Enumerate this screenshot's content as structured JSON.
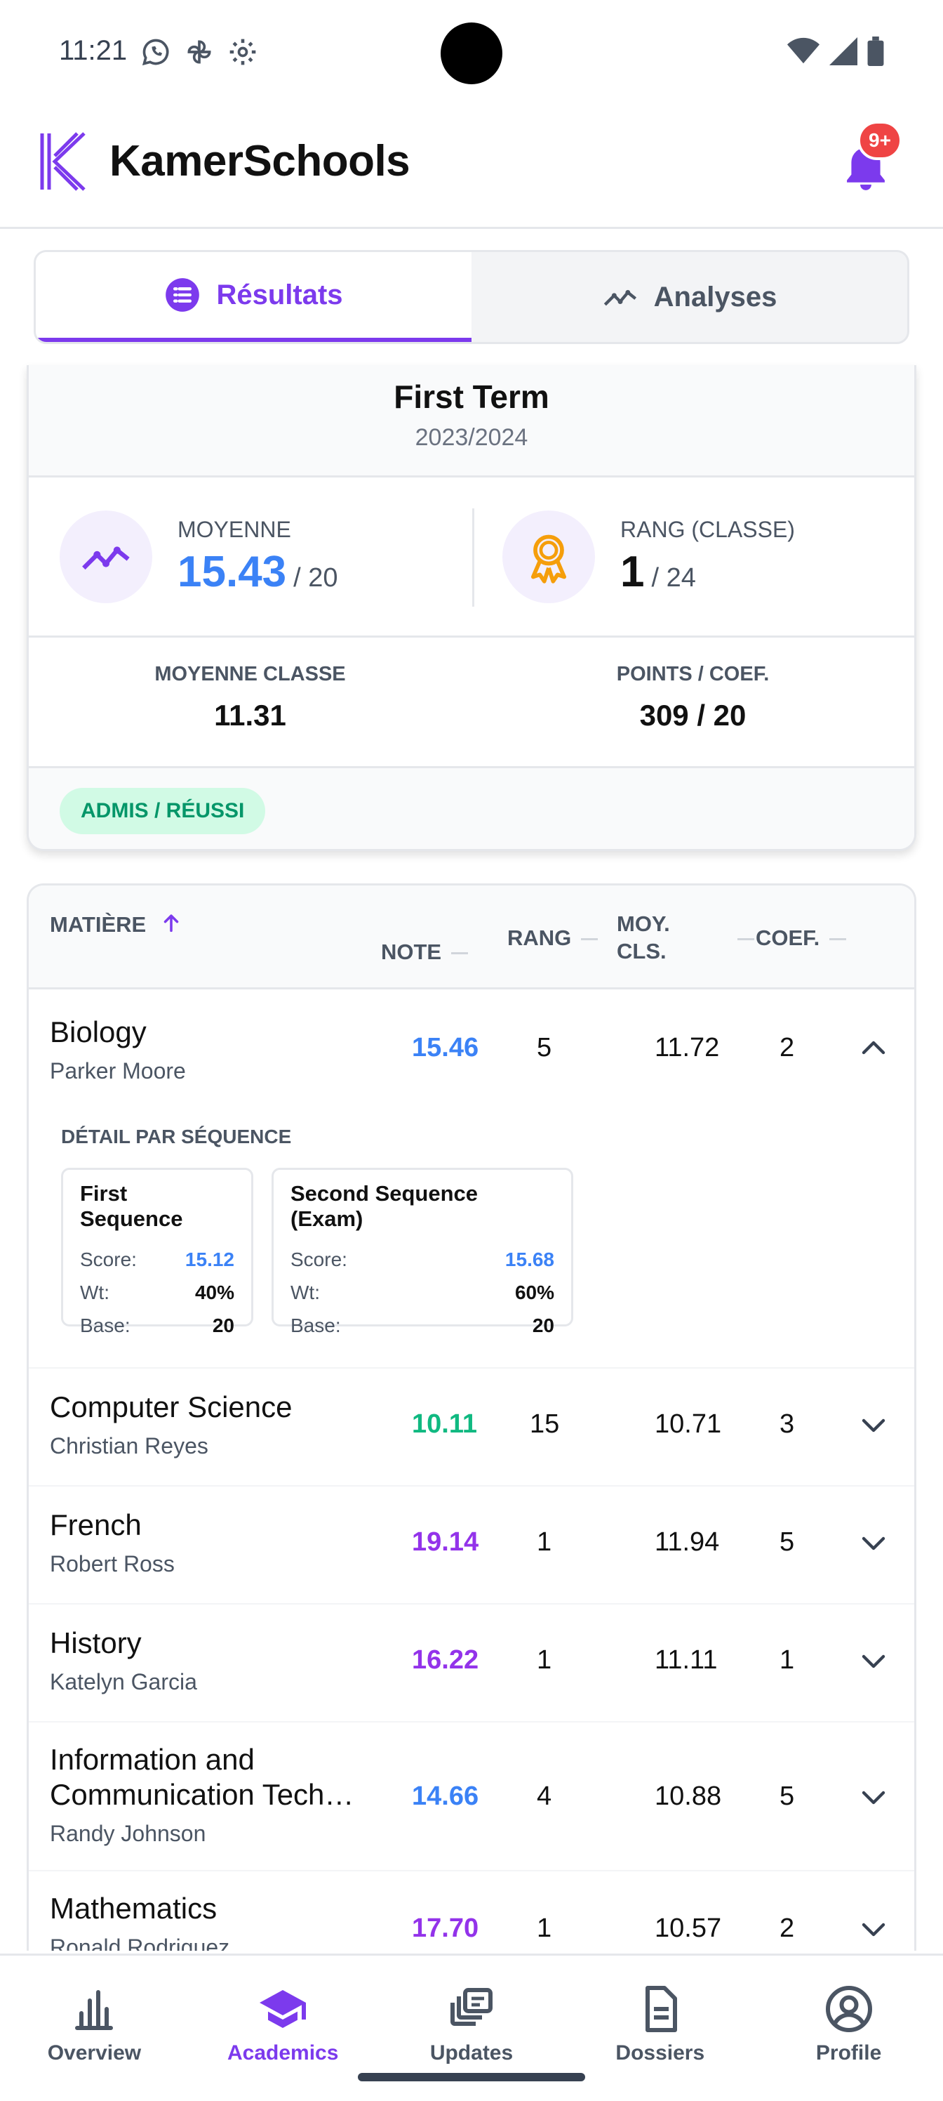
{
  "status_bar": {
    "time": "11:21"
  },
  "app": {
    "name": "KamerSchools",
    "notification_badge": "9+"
  },
  "tabs": [
    {
      "label": "Résultats",
      "icon": "list-icon",
      "active": true
    },
    {
      "label": "Analyses",
      "icon": "trend-icon",
      "active": false
    }
  ],
  "summary": {
    "term": "First Term",
    "year": "2023/2024",
    "average_label": "MOYENNE",
    "average": "15.43",
    "average_out_of": "/ 20",
    "rank_label": "RANG (CLASSE)",
    "rank": "1",
    "rank_out_of": "/ 24",
    "class_average_label": "MOYENNE CLASSE",
    "class_average": "11.31",
    "points_label": "POINTS / COEF.",
    "points": "309 / 20",
    "status": "ADMIS / RÉUSSI"
  },
  "table": {
    "headers": {
      "subject": "MATIÈRE",
      "note": "NOTE",
      "rank": "RANG",
      "class_avg_line1": "MOY.",
      "class_avg_line2": "CLS.",
      "coef": "COEF."
    },
    "detail_title": "DÉTAIL PAR SÉQUENCE",
    "score_label": "Score:",
    "weight_label": "Wt:",
    "base_label": "Base:",
    "rows": [
      {
        "subject": "Biology",
        "teacher": "Parker Moore",
        "note": "15.46",
        "note_color": "#3b82f6",
        "rank": "5",
        "class_avg": "11.72",
        "coef": "2",
        "expanded": true,
        "sequences": [
          {
            "name": "First Sequence",
            "score": "15.12",
            "weight": "40%",
            "base": "20"
          },
          {
            "name": "Second Sequence (Exam)",
            "score": "15.68",
            "weight": "60%",
            "base": "20"
          }
        ]
      },
      {
        "subject": "Computer Science",
        "teacher": "Christian Reyes",
        "note": "10.11",
        "note_color": "#10b981",
        "rank": "15",
        "class_avg": "10.71",
        "coef": "3"
      },
      {
        "subject": "French",
        "teacher": "Robert Ross",
        "note": "19.14",
        "note_color": "#9333ea",
        "rank": "1",
        "class_avg": "11.94",
        "coef": "5"
      },
      {
        "subject": "History",
        "teacher": "Katelyn Garcia",
        "note": "16.22",
        "note_color": "#9333ea",
        "rank": "1",
        "class_avg": "11.11",
        "coef": "1"
      },
      {
        "subject_line1": "Information and",
        "subject_line2": "Communication Tech…",
        "teacher": "Randy Johnson",
        "note": "14.66",
        "note_color": "#3b82f6",
        "rank": "4",
        "class_avg": "10.88",
        "coef": "5"
      },
      {
        "subject": "Mathematics",
        "teacher": "Ronald Rodriguez",
        "note": "17.70",
        "note_color": "#9333ea",
        "rank": "1",
        "class_avg": "10.57",
        "coef": "2"
      }
    ]
  },
  "bottom_nav": [
    {
      "label": "Overview",
      "icon": "bar-chart-icon"
    },
    {
      "label": "Academics",
      "icon": "graduation-cap-icon",
      "active": true
    },
    {
      "label": "Updates",
      "icon": "stack-icon"
    },
    {
      "label": "Dossiers",
      "icon": "document-icon"
    },
    {
      "label": "Profile",
      "icon": "user-circle-icon"
    }
  ],
  "colors": {
    "accent": "#7c3aed",
    "blue": "#3b82f6",
    "green": "#10b981",
    "purple": "#9333ea",
    "badge_red": "#ef4444"
  }
}
